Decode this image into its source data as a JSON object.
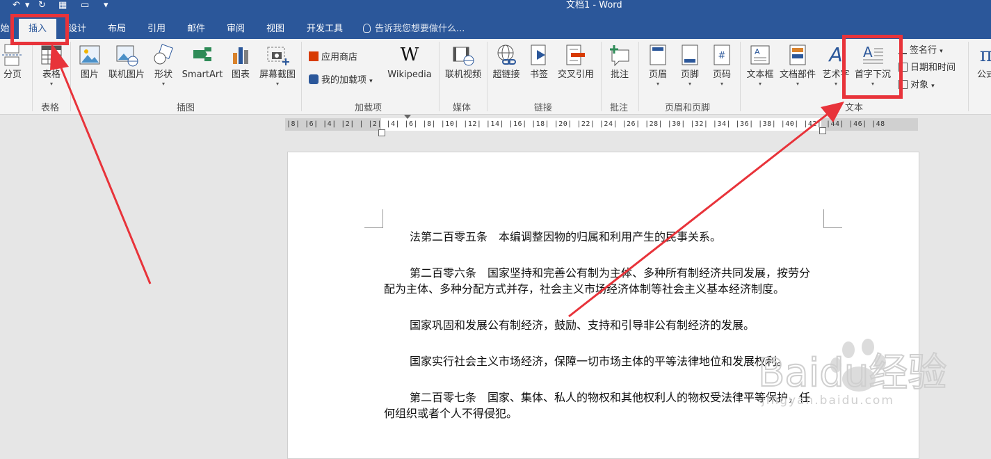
{
  "window": {
    "title": "文档1 - Word"
  },
  "qat": {
    "undo": "↶",
    "redo": "↻",
    "dropdown": "▾"
  },
  "tabs": [
    {
      "label": "始"
    },
    {
      "label": "插入"
    },
    {
      "label": "设计"
    },
    {
      "label": "布局"
    },
    {
      "label": "引用"
    },
    {
      "label": "邮件"
    },
    {
      "label": "审阅"
    },
    {
      "label": "视图"
    },
    {
      "label": "开发工具"
    }
  ],
  "tellme": {
    "text": "告诉我您想要做什么..."
  },
  "ribbon": {
    "pages": {
      "page_break": "分页"
    },
    "tables": {
      "table": "表格",
      "group": "表格"
    },
    "illustrations": {
      "pictures": "图片",
      "online_pictures": "联机图片",
      "shapes": "形状",
      "smartart": "SmartArt",
      "chart": "图表",
      "screenshot": "屏幕截图",
      "group": "插图"
    },
    "addins": {
      "store": "应用商店",
      "my_addins": "我的加载项",
      "wikipedia": "Wikipedia",
      "group": "加载项"
    },
    "media": {
      "online_video": "联机视频",
      "group": "媒体"
    },
    "links": {
      "hyperlink": "超链接",
      "bookmark": "书签",
      "cross_ref": "交叉引用",
      "group": "链接"
    },
    "comments": {
      "comment": "批注",
      "group": "批注"
    },
    "header_footer": {
      "header": "页眉",
      "footer": "页脚",
      "page_number": "页码",
      "group": "页眉和页脚"
    },
    "text": {
      "textbox": "文本框",
      "quick_parts": "文档部件",
      "wordart": "艺术字",
      "drop_cap": "首字下沉",
      "signature_line": "签名行",
      "date_time": "日期和时间",
      "object": "对象",
      "group": "文本"
    },
    "symbols": {
      "equation": "公式"
    }
  },
  "ruler": {
    "text": "|8|  |6|  |4|  |2|  |   |2|  |4|  |6|  |8| |10| |12| |14| |16| |18| |20| |22| |24| |26| |28| |30| |32| |34| |36| |38| |40| |42| |44| |46| |48"
  },
  "document": {
    "paragraphs": [
      "法第二百零五条　本编调整因物的归属和利用产生的民事关系。",
      "第二百零六条　国家坚持和完善公有制为主体、多种所有制经济共同发展，按劳分配为主体、多种分配方式并存，社会主义市场经济体制等社会主义基本经济制度。",
      "国家巩固和发展公有制经济，鼓励、支持和引导非公有制经济的发展。",
      "国家实行社会主义市场经济，保障一切市场主体的平等法律地位和发展权利。",
      "第二百零七条　国家、集体、私人的物权和其他权利人的物权受法律平等保护，任何组织或者个人不得侵犯。"
    ]
  },
  "watermark": {
    "brand": "Baidu经验",
    "url": "jingyan.baidu.com"
  },
  "colors": {
    "title_bar": "#2b579a",
    "highlight": "#e8333a",
    "ribbon": "#f3f3f3"
  }
}
